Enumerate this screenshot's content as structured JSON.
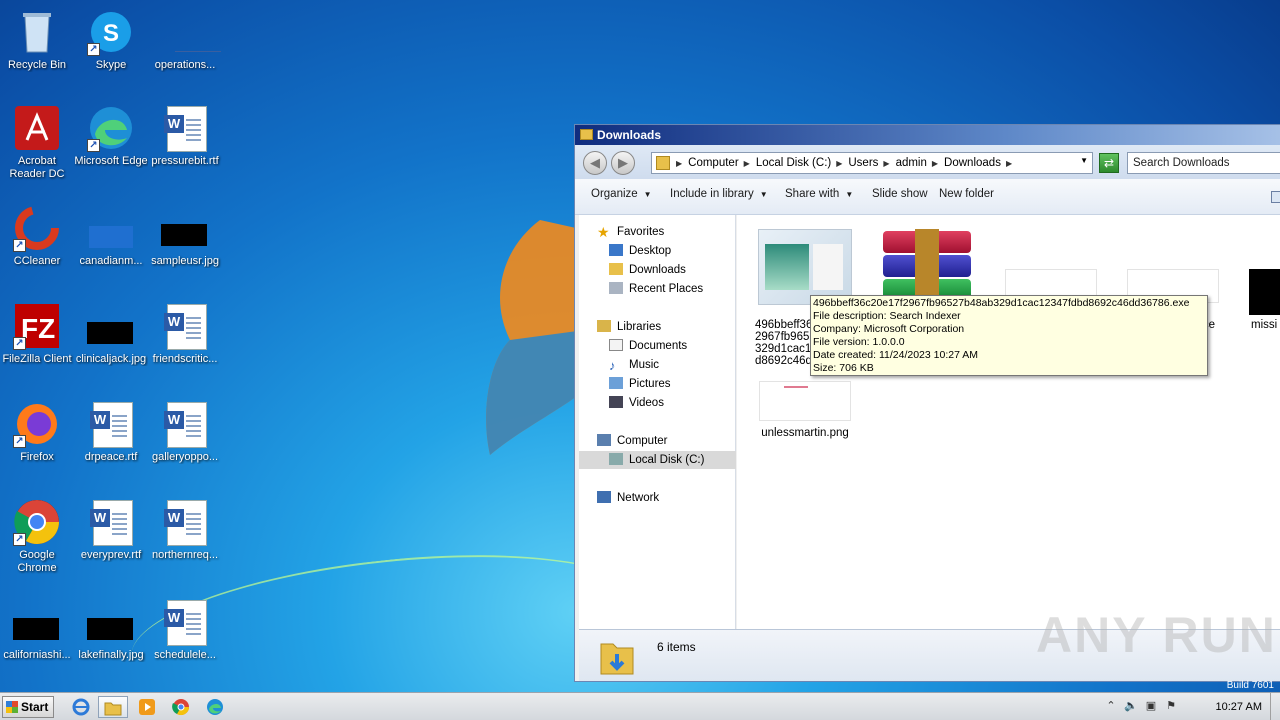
{
  "desktop": {
    "icons": [
      {
        "label": "Recycle Bin",
        "icon": "recycle-bin-icon"
      },
      {
        "label": "Skype",
        "icon": "skype-icon"
      },
      {
        "label": "operations...",
        "icon": "file-thumbnail-icon"
      },
      {
        "label": "Acrobat Reader DC",
        "icon": "acrobat-icon"
      },
      {
        "label": "Microsoft Edge",
        "icon": "edge-icon"
      },
      {
        "label": "pressurebit.rtf",
        "icon": "word-document-icon"
      },
      {
        "label": "CCleaner",
        "icon": "ccleaner-icon"
      },
      {
        "label": "canadianm...",
        "icon": "file-thumbnail-icon"
      },
      {
        "label": "sampleusr.jpg",
        "icon": "image-thumbnail-icon"
      },
      {
        "label": "FileZilla Client",
        "icon": "filezilla-icon"
      },
      {
        "label": "clinicaljack.jpg",
        "icon": "image-thumbnail-icon"
      },
      {
        "label": "friendscritic...",
        "icon": "word-document-icon"
      },
      {
        "label": "Firefox",
        "icon": "firefox-icon"
      },
      {
        "label": "drpeace.rtf",
        "icon": "word-document-icon"
      },
      {
        "label": "galleryoppo...",
        "icon": "word-document-icon"
      },
      {
        "label": "Google Chrome",
        "icon": "chrome-icon"
      },
      {
        "label": "everyprev.rtf",
        "icon": "word-document-icon"
      },
      {
        "label": "northernreq...",
        "icon": "word-document-icon"
      },
      {
        "label": "californiashi...",
        "icon": "image-thumbnail-icon"
      },
      {
        "label": "lakefinally.jpg",
        "icon": "image-thumbnail-icon"
      },
      {
        "label": "schedulele...",
        "icon": "word-document-icon"
      }
    ]
  },
  "explorer": {
    "title": "Downloads",
    "breadcrumb": [
      "Computer",
      "Local Disk (C:)",
      "Users",
      "admin",
      "Downloads"
    ],
    "search_placeholder": "Search Downloads",
    "toolbar": {
      "organize": "Organize",
      "include_in_library": "Include in library",
      "share_with": "Share with",
      "slide_show": "Slide show",
      "new_folder": "New folder"
    },
    "nav": {
      "favorites": "Favorites",
      "desktop": "Desktop",
      "downloads": "Downloads",
      "recent_places": "Recent Places",
      "libraries": "Libraries",
      "documents": "Documents",
      "music": "Music",
      "pictures": "Pictures",
      "videos": "Videos",
      "computer": "Computer",
      "local_disk": "Local Disk (C:)",
      "network": "Network"
    },
    "files": [
      {
        "name_lines": [
          "496bbeff36",
          "2967fb9652",
          "329d1cac12",
          "d8692c46d"
        ],
        "type": "exe"
      },
      {
        "name": "",
        "type": "winrar"
      },
      {
        "name": "",
        "type": "blank"
      },
      {
        "name": "ce",
        "type": "blank"
      },
      {
        "name": "missi",
        "type": "black"
      },
      {
        "name": "unlessmartin.png",
        "type": "png"
      }
    ],
    "status": {
      "count": "6 items"
    }
  },
  "tooltip": {
    "filename": "496bbeff36c20e17f2967fb96527b48ab329d1cac12347fdbd8692c46dd36786.exe",
    "description": "File description: Search Indexer",
    "company": "Company: Microsoft Corporation",
    "version": "File version: 1.0.0.0",
    "created": "Date created: 11/24/2023 10:27 AM",
    "size": "Size: 706 KB"
  },
  "watermark": "ANY RUN",
  "build": "Build 7601",
  "taskbar": {
    "start": "Start",
    "apps": [
      "internet-explorer-icon",
      "explorer-folder-icon",
      "media-player-icon",
      "chrome-icon",
      "edge-icon"
    ],
    "clock": "10:27 AM"
  }
}
